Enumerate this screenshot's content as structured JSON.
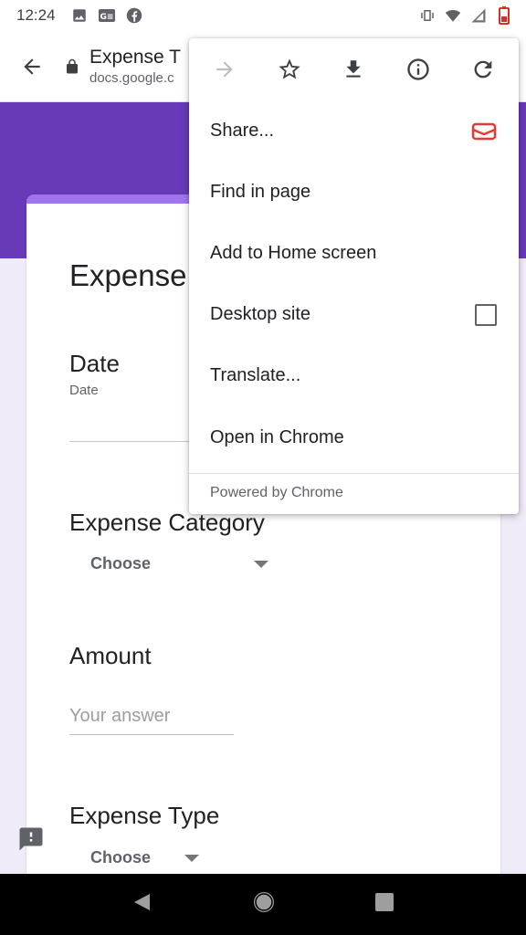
{
  "status_bar": {
    "time": "12:24",
    "left_icons": [
      "image-icon",
      "gs-icon",
      "facebook-icon"
    ],
    "right_icons": [
      "vibrate-icon",
      "wifi-icon",
      "signal-icon",
      "battery-icon"
    ]
  },
  "toolbar": {
    "title": "Expense T",
    "url": "docs.google.c"
  },
  "form": {
    "title": "Expense",
    "date_label": "Date",
    "date_sub": "Date",
    "category_label": "Expense Category",
    "category_select": "Choose",
    "amount_label": "Amount",
    "amount_placeholder": "Your answer",
    "type_label": "Expense Type",
    "type_select": "Choose"
  },
  "menu": {
    "icons": [
      "forward-icon",
      "star-icon",
      "download-icon",
      "info-icon",
      "refresh-icon"
    ],
    "items": [
      {
        "label": "Share..."
      },
      {
        "label": "Find in page"
      },
      {
        "label": "Add to Home screen"
      },
      {
        "label": "Desktop site",
        "checked": false
      },
      {
        "label": "Translate..."
      },
      {
        "label": "Open in Chrome"
      }
    ],
    "footer": "Powered by Chrome"
  },
  "colors": {
    "accent": "#673ab7",
    "card_top": "#9f74ee",
    "share_icon": "#e53935"
  }
}
